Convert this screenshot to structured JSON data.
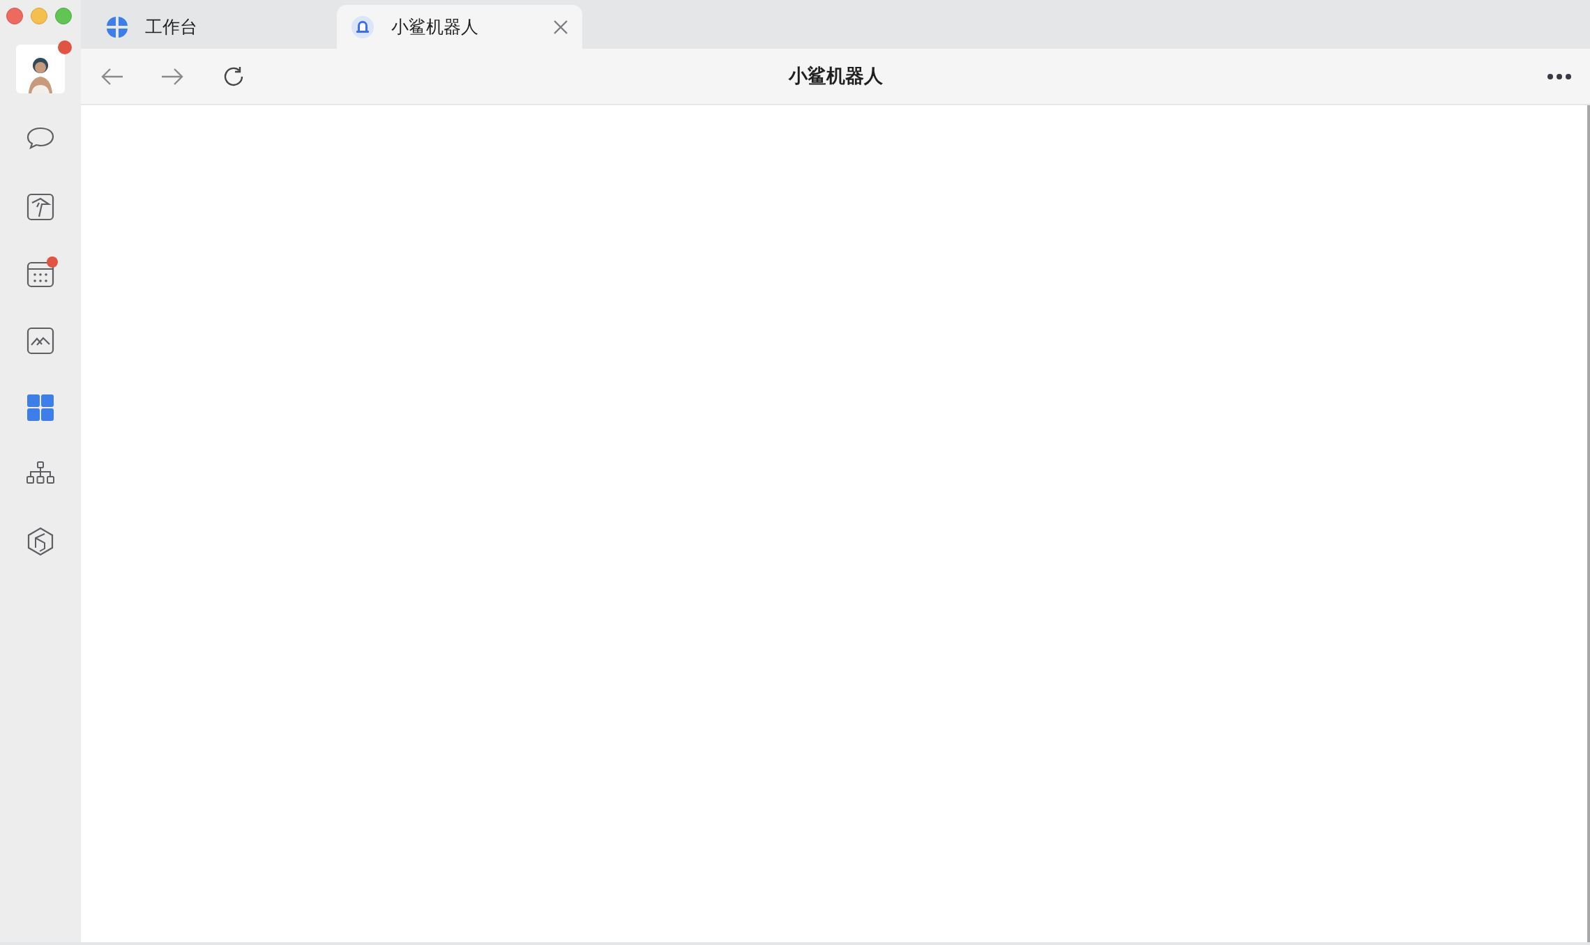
{
  "sidebar": {
    "avatar": {
      "badge": true
    },
    "items": [
      {
        "selected": false,
        "badge": false
      },
      {
        "selected": false,
        "badge": false
      },
      {
        "selected": false,
        "badge": true
      },
      {
        "selected": false,
        "badge": false
      },
      {
        "selected": true,
        "badge": false
      },
      {
        "selected": false,
        "badge": false
      },
      {
        "selected": false,
        "badge": false
      }
    ]
  },
  "tabs": [
    {
      "label": "工作台",
      "selected": false,
      "closable": false
    },
    {
      "label": "小鲨机器人",
      "selected": true,
      "closable": true
    }
  ],
  "toolbar": {
    "title": "小鲨机器人"
  }
}
